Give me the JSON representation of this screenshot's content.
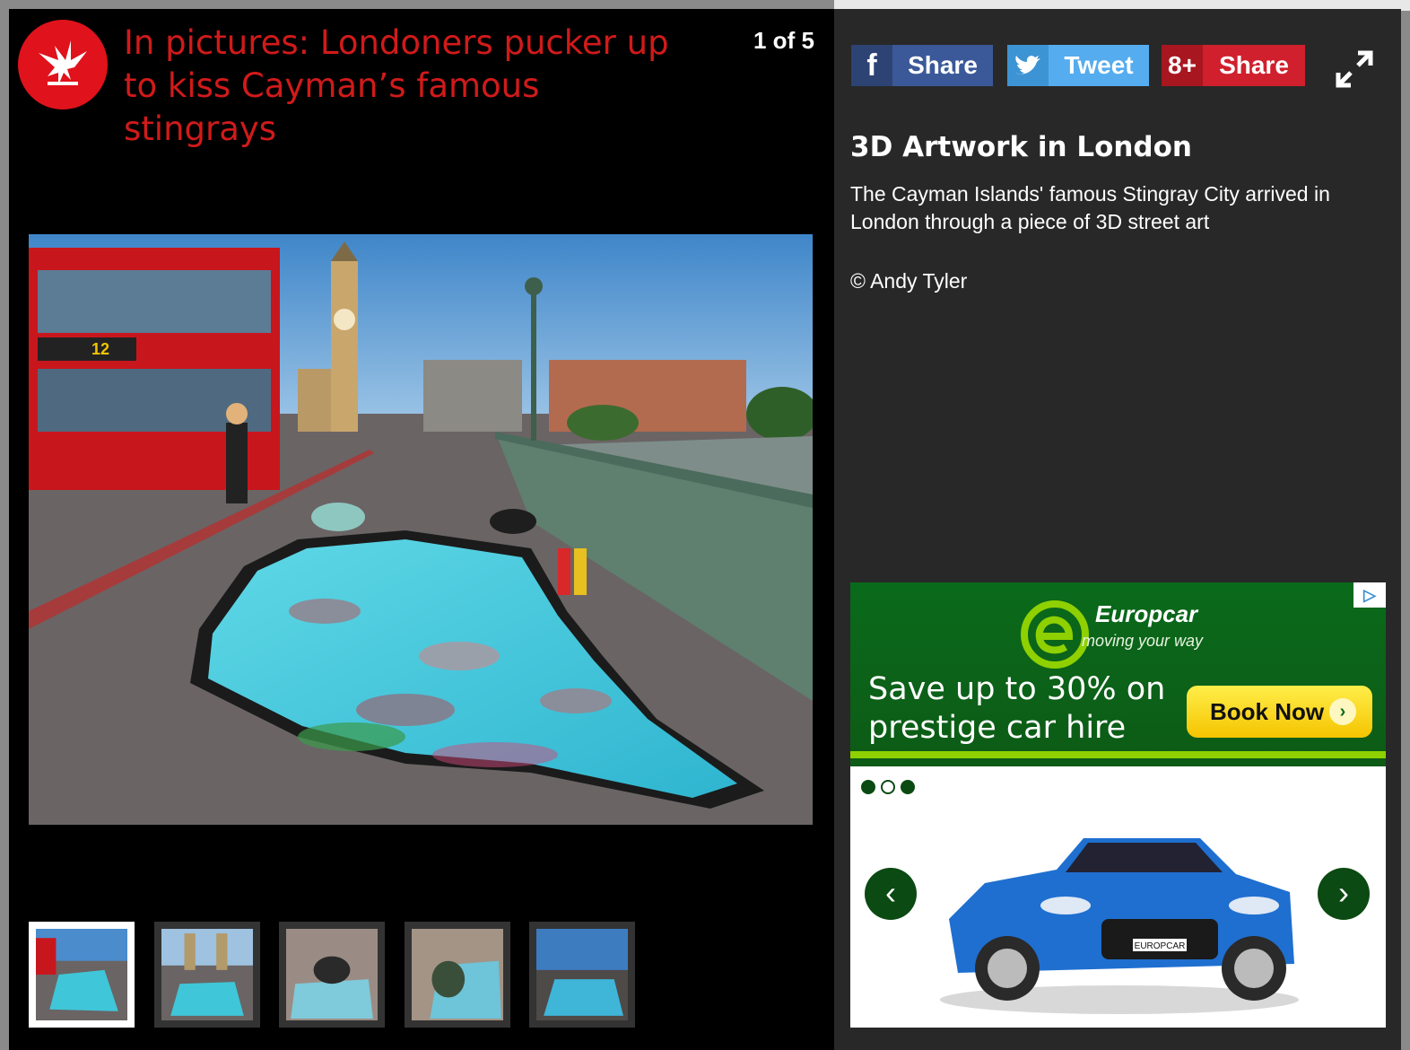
{
  "publication": {
    "logo_icon": "eagle-icon",
    "headline": "In pictures: Londoners pucker up to kiss Cayman’s famous stingrays"
  },
  "gallery": {
    "counter": "1 of 5",
    "thumbnails": [
      {
        "name": "thumbnail-1",
        "active": true
      },
      {
        "name": "thumbnail-2",
        "active": false
      },
      {
        "name": "thumbnail-3",
        "active": false
      },
      {
        "name": "thumbnail-4",
        "active": false
      },
      {
        "name": "thumbnail-5",
        "active": false
      }
    ],
    "bus_route": "12"
  },
  "share": {
    "facebook": {
      "icon": "f",
      "label": "Share"
    },
    "twitter": {
      "label": "Tweet"
    },
    "google": {
      "icon": "8+",
      "label": "Share"
    }
  },
  "caption": {
    "title": "3D Artwork in London",
    "description": "The Cayman Islands' famous Stingray City arrived in London through a piece of 3D street art",
    "credit": "© Andy Tyler"
  },
  "ad": {
    "brand": "Europcar",
    "slogan": "moving your way",
    "offer": "Save up to 30% on prestige car hire",
    "cta": "Book Now",
    "cta_arrow": "›",
    "prev_arrow": "‹",
    "next_arrow": "›",
    "adchoices_icon": "▷",
    "plate": "EUROPCAR",
    "colors": {
      "green": "#0a6a1b",
      "yellow": "#f5c400"
    }
  }
}
